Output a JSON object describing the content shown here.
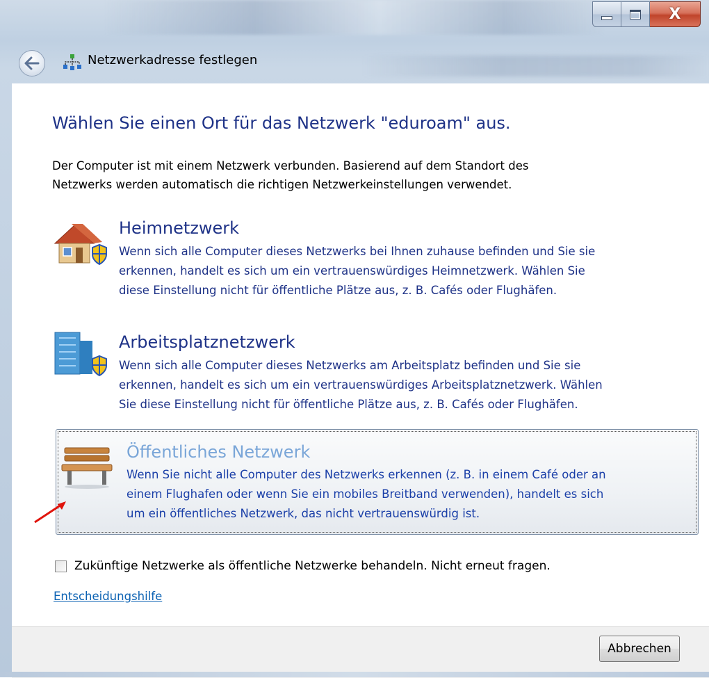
{
  "window": {
    "title": "Netzwerkadresse festlegen",
    "caption_buttons": {
      "minimize_icon": "minimize-icon",
      "maximize_icon": "maximize-icon",
      "close_label": "X"
    }
  },
  "nav": {
    "back_icon": "back-arrow-icon",
    "title_icon": "network-icon",
    "title": "Netzwerkadresse festlegen"
  },
  "main": {
    "heading": "Wählen Sie einen Ort für das Netzwerk \"eduroam\" aus.",
    "intro": [
      "Der Computer ist mit einem Netzwerk verbunden. Basierend auf dem Standort des",
      "Netzwerks werden automatisch die richtigen Netzwerkeinstellungen verwendet."
    ],
    "options": [
      {
        "icon": "house-shield-icon",
        "title": "Heimnetzwerk",
        "desc": [
          "Wenn sich alle Computer dieses Netzwerks bei Ihnen zuhause befinden und Sie sie",
          "erkennen, handelt es sich um ein vertrauenswürdiges Heimnetzwerk. Wählen Sie",
          "diese Einstellung nicht für öffentliche Plätze aus, z. B. Cafés oder Flughäfen."
        ]
      },
      {
        "icon": "office-building-shield-icon",
        "title": "Arbeitsplatznetzwerk",
        "desc": [
          "Wenn sich alle Computer dieses Netzwerks am Arbeitsplatz befinden und Sie sie",
          "erkennen, handelt es sich um ein vertrauenswürdiges Arbeitsplatznetzwerk. Wählen",
          "Sie diese Einstellung nicht für öffentliche Plätze aus, z. B. Cafés oder Flughäfen."
        ]
      },
      {
        "icon": "park-bench-icon",
        "title": "Öffentliches Netzwerk",
        "selected": true,
        "desc": [
          "Wenn Sie nicht alle Computer des Netzwerks erkennen (z. B. in einem Café oder an",
          "einem Flughafen oder wenn Sie ein mobiles Breitband verwenden), handelt es sich",
          "um ein öffentliches Netzwerk, das nicht vertrauenswürdig ist."
        ]
      }
    ],
    "checkbox": {
      "checked": false,
      "label": "Zukünftige Netzwerke als öffentliche Netzwerke behandeln. Nicht erneut fragen."
    },
    "help_link": "Entscheidungshilfe"
  },
  "footer": {
    "cancel_label": "Abbrechen"
  },
  "colors": {
    "heading": "#1e3287",
    "link": "#0b62b3",
    "selected_title": "#7aa6d8",
    "annotation_arrow": "#e0140c"
  }
}
